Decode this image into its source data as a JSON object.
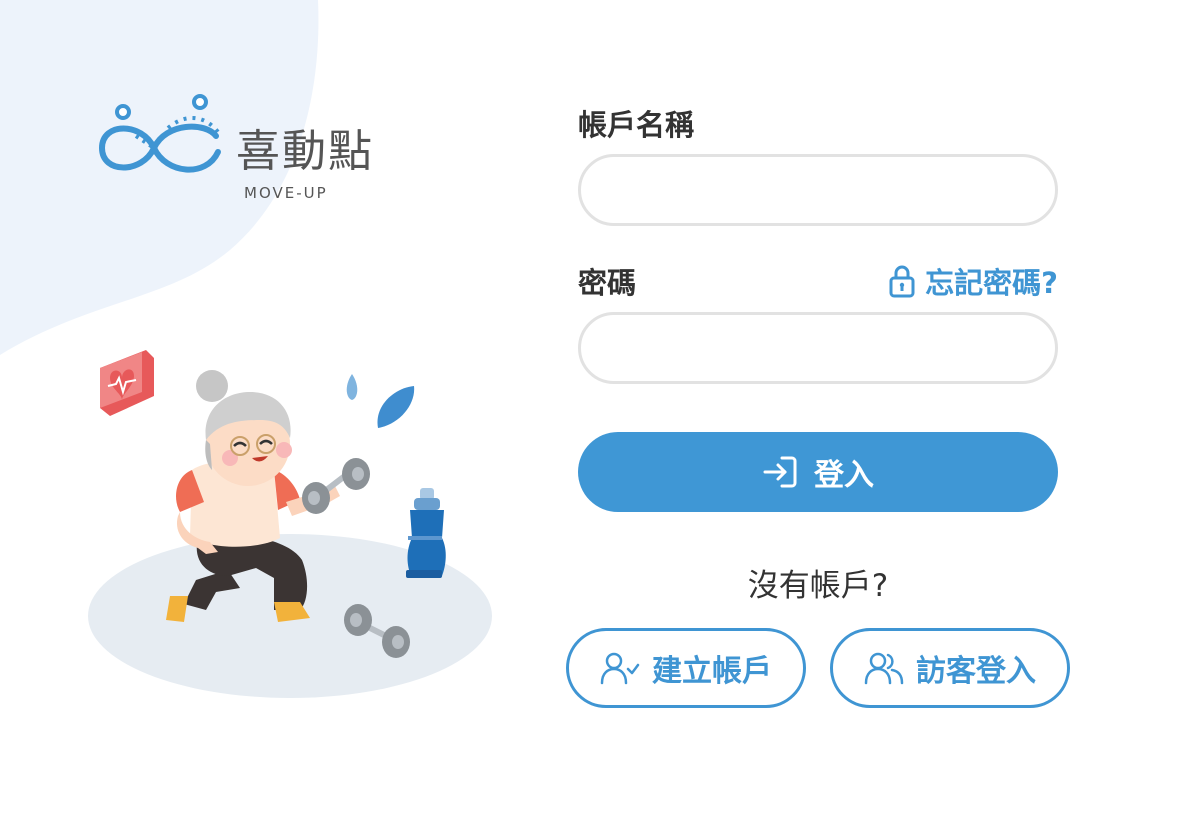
{
  "brand": {
    "name": "喜動點",
    "subtitle": "MOVE-UP",
    "color": "#3f95d3"
  },
  "form": {
    "username_label": "帳戶名稱",
    "username_value": "",
    "password_label": "密碼",
    "password_value": "",
    "forgot_password": "忘記密碼?",
    "login_button": "登入",
    "no_account_text": "沒有帳戶?",
    "create_account_button": "建立帳戶",
    "guest_login_button": "訪客登入"
  },
  "icons": {
    "forgot": "lock-icon",
    "login": "login-arrow-icon",
    "create_account": "user-check-icon",
    "guest": "users-icon"
  },
  "colors": {
    "accent": "#3f97d5",
    "background_blob": "#edf3fb",
    "input_border": "#e2e2e2",
    "text": "#333333"
  }
}
